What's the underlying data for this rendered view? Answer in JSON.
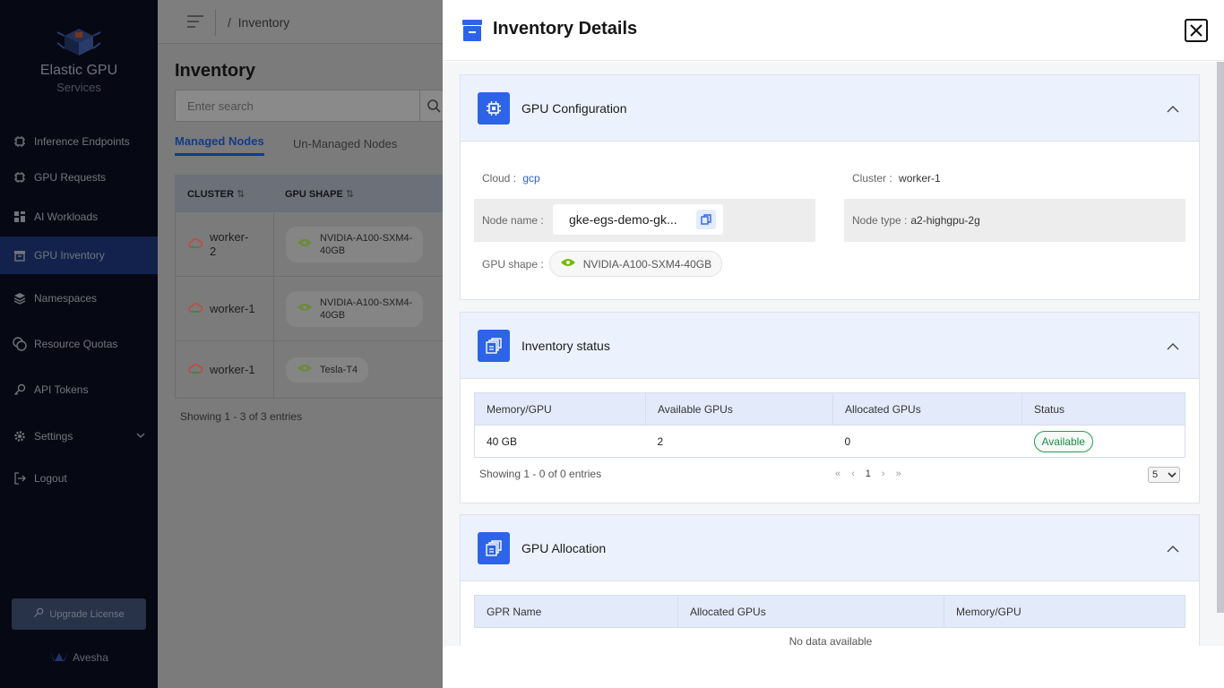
{
  "sidebar": {
    "brand_title": "Elastic GPU",
    "brand_sub": "Services",
    "items": [
      {
        "label": "Inference Endpoints",
        "icon": "chip-gear-icon"
      },
      {
        "label": "GPU Requests",
        "icon": "chip-icon"
      },
      {
        "label": "AI Workloads",
        "icon": "grid-icon"
      },
      {
        "label": "GPU Inventory",
        "icon": "archive-icon"
      },
      {
        "label": "Namespaces",
        "icon": "layers-icon"
      },
      {
        "label": "Resource Quotas",
        "icon": "coins-icon"
      },
      {
        "label": "API Tokens",
        "icon": "key-icon"
      },
      {
        "label": "Settings",
        "icon": "gear-icon"
      },
      {
        "label": "Logout",
        "icon": "logout-icon"
      }
    ],
    "upgrade_label": "Upgrade License",
    "footer_brand": "Avesha"
  },
  "page": {
    "breadcrumb": "Inventory",
    "title": "Inventory",
    "search_placeholder": "Enter search",
    "tabs": [
      "Managed Nodes",
      "Un-Managed Nodes"
    ],
    "columns": [
      "CLUSTER",
      "GPU SHAPE"
    ],
    "rows": [
      {
        "cluster": "worker-\n2",
        "shape": "NVIDIA-A100-SXM4-\n40GB"
      },
      {
        "cluster": "worker-1",
        "shape": "NVIDIA-A100-SXM4-\n40GB"
      },
      {
        "cluster": "worker-1",
        "shape": "Tesla-T4"
      }
    ],
    "showing": "Showing 1 - 3 of 3 entries"
  },
  "drawer": {
    "title": "Inventory Details",
    "gpu_config": {
      "title": "GPU Configuration",
      "cloud_label": "Cloud :",
      "cloud_value": "gcp",
      "cluster_label": "Cluster :",
      "cluster_value": "worker-1",
      "node_name_label": "Node name :",
      "node_name_value": "gke-egs-demo-gk...",
      "node_type_label": "Node type :",
      "node_type_value": "a2-highgpu-2g",
      "gpu_shape_label": "GPU shape :",
      "gpu_shape_value": "NVIDIA-A100-SXM4-40GB"
    },
    "inventory_status": {
      "title": "Inventory status",
      "columns": [
        "Memory/GPU",
        "Available GPUs",
        "Allocated GPUs",
        "Status"
      ],
      "row": {
        "memory": "40 GB",
        "available": "2",
        "allocated": "0",
        "status": "Available"
      },
      "showing": "Showing 1 - 0 of 0 entries",
      "page_first": "«",
      "page_prev": "‹",
      "page_num": "1",
      "page_next": "›",
      "page_last": "»",
      "page_size": "5"
    },
    "gpu_allocation": {
      "title": "GPU Allocation",
      "columns": [
        "GPR Name",
        "Allocated GPUs",
        "Memory/GPU"
      ],
      "empty": "No data available"
    }
  },
  "colors": {
    "accent": "#2d63e6",
    "sidebar_bg": "#0b1023",
    "status_green": "#22894c"
  }
}
